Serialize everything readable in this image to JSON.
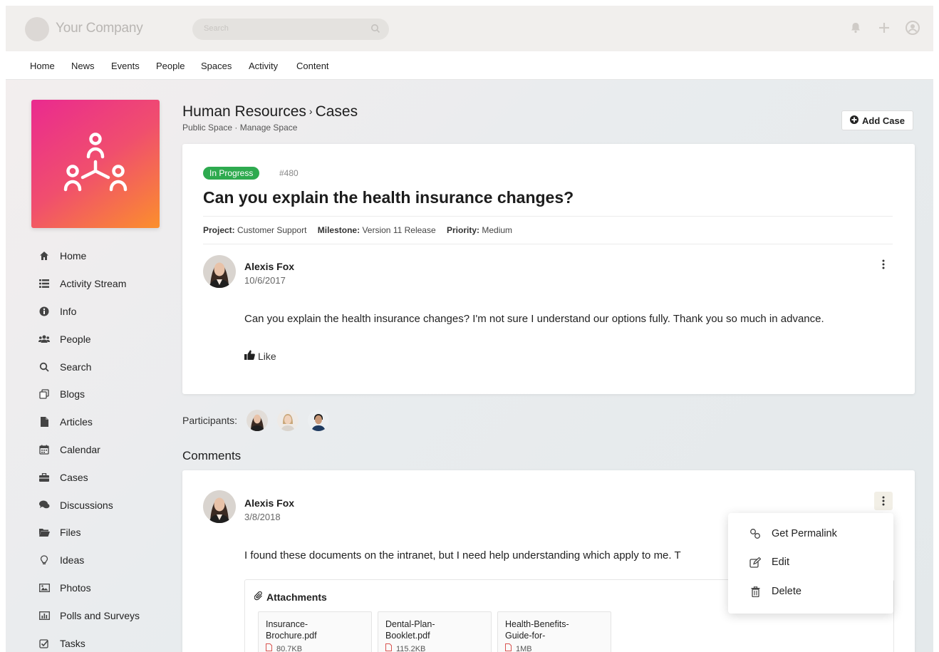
{
  "header": {
    "brand_name": "Your Company",
    "search_placeholder": "Search"
  },
  "nav": [
    "Home",
    "News",
    "Events",
    "People",
    "Spaces",
    "Activity",
    "Content"
  ],
  "sidebar": {
    "items": [
      {
        "label": "Home",
        "icon": "home-icon"
      },
      {
        "label": "Activity Stream",
        "icon": "list-icon"
      },
      {
        "label": "Info",
        "icon": "info-icon"
      },
      {
        "label": "People",
        "icon": "people-icon"
      },
      {
        "label": "Search",
        "icon": "search-icon"
      },
      {
        "label": "Blogs",
        "icon": "blogs-icon"
      },
      {
        "label": "Articles",
        "icon": "file-icon"
      },
      {
        "label": "Calendar",
        "icon": "calendar-icon"
      },
      {
        "label": "Cases",
        "icon": "briefcase-icon"
      },
      {
        "label": "Discussions",
        "icon": "chat-icon"
      },
      {
        "label": "Files",
        "icon": "folder-icon"
      },
      {
        "label": "Ideas",
        "icon": "lightbulb-icon"
      },
      {
        "label": "Photos",
        "icon": "image-icon"
      },
      {
        "label": "Polls and Surveys",
        "icon": "bar-chart-icon"
      },
      {
        "label": "Tasks",
        "icon": "checkbox-icon"
      }
    ]
  },
  "page": {
    "title_part1": "Human Resources",
    "title_sep": "›",
    "title_part2": "Cases",
    "subtitle": "Public Space · Manage Space",
    "add_case_label": "Add Case"
  },
  "case": {
    "status": "In Progress",
    "status_color": "#2eaa4f",
    "number": "#480",
    "title": "Can you explain the health insurance changes?",
    "meta": {
      "project_label": "Project:",
      "project_value": "Customer Support",
      "milestone_label": "Milestone:",
      "milestone_value": "Version 11 Release",
      "priority_label": "Priority:",
      "priority_value": "Medium"
    },
    "author": "Alexis Fox",
    "date": "10/6/2017",
    "body": "Can you explain the health insurance changes? I'm not sure I understand our options fully. Thank you so much in advance.",
    "like_label": "Like"
  },
  "participants_label": "Participants:",
  "comments_title": "Comments",
  "comment": {
    "author": "Alexis Fox",
    "date": "3/8/2018",
    "body": "I found these documents on the intranet, but I need help understanding which apply to me. T",
    "attachments_title": "Attachments",
    "attachments": [
      {
        "name_line1": "Insurance-",
        "name_line2": "Brochure.pdf",
        "size": "80.7KB"
      },
      {
        "name_line1": "Dental-Plan-",
        "name_line2": "Booklet.pdf",
        "size": "115.2KB"
      },
      {
        "name_line1": "Health-Benefits-",
        "name_line2": "Guide-for-",
        "size": "1MB"
      }
    ]
  },
  "context_menu": {
    "items": [
      {
        "label": "Get Permalink",
        "icon": "link-icon"
      },
      {
        "label": "Edit",
        "icon": "edit-icon"
      },
      {
        "label": "Delete",
        "icon": "trash-icon"
      }
    ]
  },
  "colors": {
    "accent_gradient_start": "#ea2a8f",
    "accent_gradient_end": "#fb8f2c"
  }
}
